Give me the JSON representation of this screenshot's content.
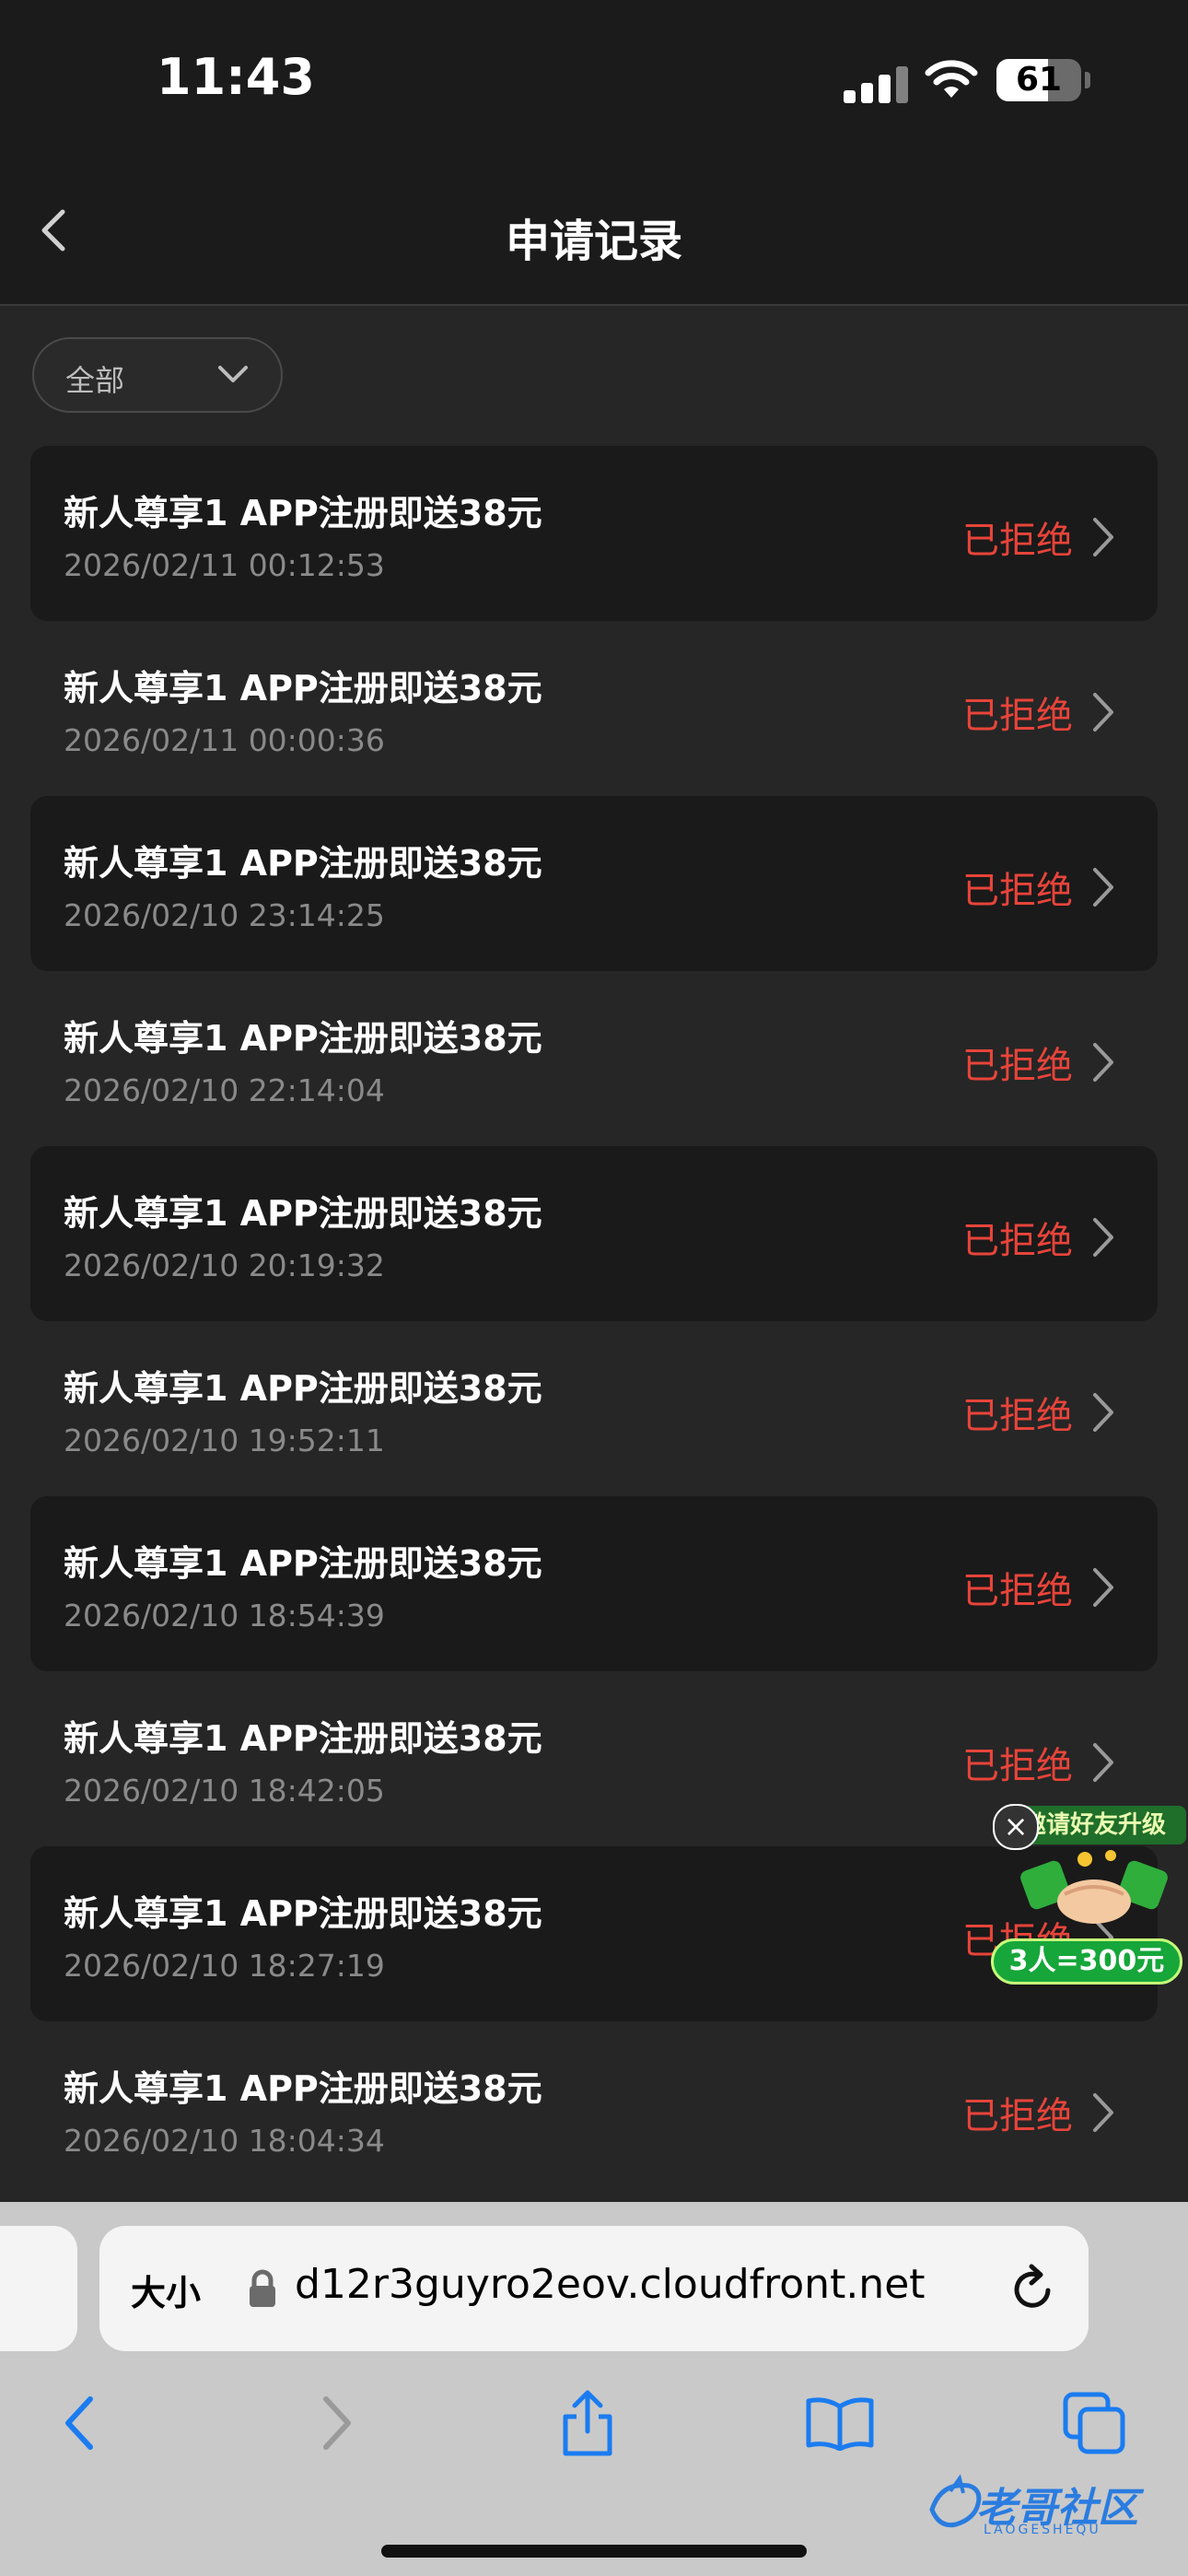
{
  "status_bar": {
    "time": "11:43",
    "battery": "61",
    "battery_level": 0.61
  },
  "header": {
    "title": "申请记录"
  },
  "filter": {
    "label": "全部"
  },
  "records": [
    {
      "title": "新人尊享1 APP注册即送38元",
      "date": "2026/02/11 00:12:53",
      "status": "已拒绝"
    },
    {
      "title": "新人尊享1 APP注册即送38元",
      "date": "2026/02/11 00:00:36",
      "status": "已拒绝"
    },
    {
      "title": "新人尊享1 APP注册即送38元",
      "date": "2026/02/10 23:14:25",
      "status": "已拒绝"
    },
    {
      "title": "新人尊享1 APP注册即送38元",
      "date": "2026/02/10 22:14:04",
      "status": "已拒绝"
    },
    {
      "title": "新人尊享1 APP注册即送38元",
      "date": "2026/02/10 20:19:32",
      "status": "已拒绝"
    },
    {
      "title": "新人尊享1 APP注册即送38元",
      "date": "2026/02/10 19:52:11",
      "status": "已拒绝"
    },
    {
      "title": "新人尊享1 APP注册即送38元",
      "date": "2026/02/10 18:54:39",
      "status": "已拒绝"
    },
    {
      "title": "新人尊享1 APP注册即送38元",
      "date": "2026/02/10 18:42:05",
      "status": "已拒绝"
    },
    {
      "title": "新人尊享1 APP注册即送38元",
      "date": "2026/02/10 18:27:19",
      "status": "已拒绝"
    },
    {
      "title": "新人尊享1 APP注册即送38元",
      "date": "2026/02/10 18:04:34",
      "status": "已拒绝"
    }
  ],
  "promo": {
    "banner": "邀请好友升级",
    "offer": "3人=300元"
  },
  "browser": {
    "text_size": "大小",
    "url": "d12r3guyro2eov.cloudfront.net"
  },
  "watermark": {
    "text": "老哥社区",
    "sub": "LAOGESHEQU"
  },
  "colors": {
    "status_rejected": "#e8443a",
    "background": "#262626",
    "card": "#1a1a1a",
    "accent_blue": "#1a7cf0"
  }
}
